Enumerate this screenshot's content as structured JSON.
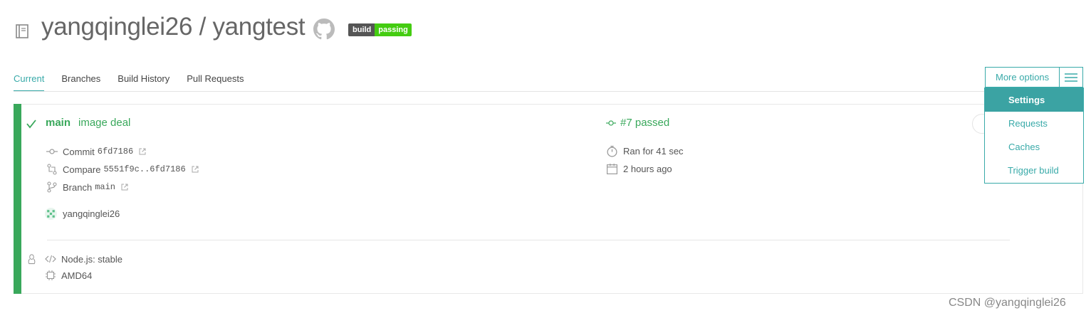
{
  "header": {
    "owner": "yangqinglei26",
    "separator": "/",
    "repo": "yangtest",
    "badge_left": "build",
    "badge_right": "passing",
    "icons": [
      "repo-book-icon",
      "github-icon"
    ]
  },
  "tabs": [
    {
      "label": "Current",
      "active": true
    },
    {
      "label": "Branches",
      "active": false
    },
    {
      "label": "Build History",
      "active": false
    },
    {
      "label": "Pull Requests",
      "active": false
    }
  ],
  "more_options": {
    "label": "More options",
    "menu": [
      {
        "label": "Settings",
        "active": true
      },
      {
        "label": "Requests",
        "active": false
      },
      {
        "label": "Caches",
        "active": false
      },
      {
        "label": "Trigger build",
        "active": false
      }
    ]
  },
  "build": {
    "status_color": "#39a85b",
    "branch": "main",
    "message": "image deal",
    "number_status": "#7 passed",
    "commit_label": "Commit",
    "commit_sha": "6fd7186",
    "compare_label": "Compare",
    "compare_range": "5551f9c..6fd7186",
    "branch_label": "Branch",
    "branch_value": "main",
    "author": "yangqinglei26",
    "duration": "Ran for 41 sec",
    "finished": "2 hours ago",
    "language": "Node.js: stable",
    "arch": "AMD64"
  },
  "watermark": "CSDN @yangqinglei26",
  "colors": {
    "accent": "#39aaa9",
    "passed": "#39a85b",
    "badge_pass": "#44cc11"
  }
}
